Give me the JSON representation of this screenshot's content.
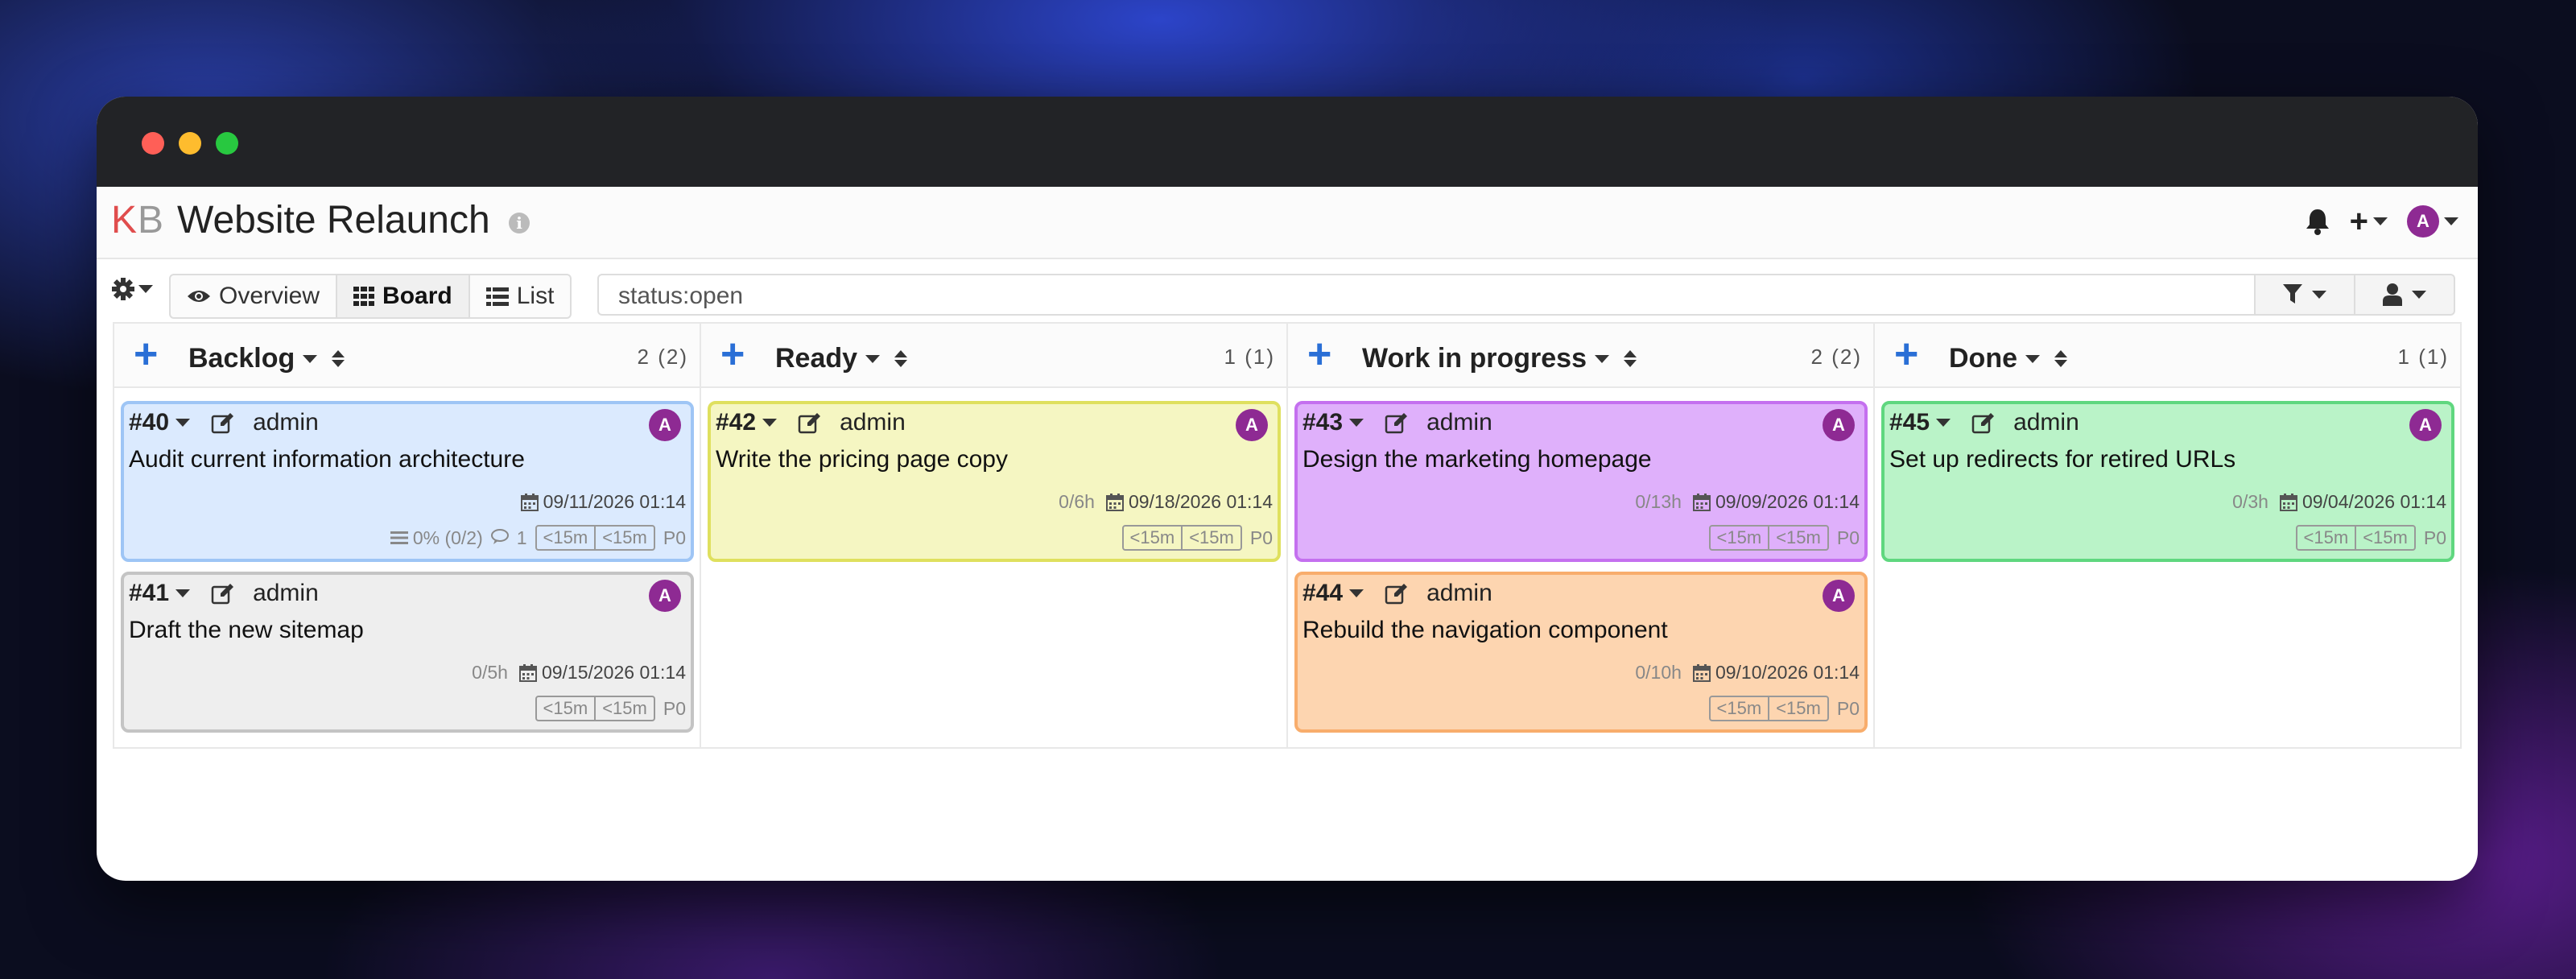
{
  "header": {
    "logo_k": "K",
    "logo_b": "B",
    "project_title": "Website Relaunch",
    "avatar_letter": "A"
  },
  "toolbar": {
    "views": [
      {
        "label": "Overview",
        "icon": "eye-icon"
      },
      {
        "label": "Board",
        "icon": "grid-icon",
        "active": true
      },
      {
        "label": "List",
        "icon": "list-icon"
      }
    ],
    "search_value": "status:open"
  },
  "columns": [
    {
      "title": "Backlog",
      "count": "2",
      "total": "(2)"
    },
    {
      "title": "Ready",
      "count": "1",
      "total": "(1)"
    },
    {
      "title": "Work in progress",
      "count": "2",
      "total": "(2)"
    },
    {
      "title": "Done",
      "count": "1",
      "total": "(1)"
    }
  ],
  "tasks": [
    {
      "id": "#40",
      "owner": "admin",
      "avatar": "A",
      "title": "Audit current information architecture",
      "time": "",
      "date": "09/11/2026 01:14",
      "progress": "0% (0/2)",
      "comments": "1",
      "est1": "<15m",
      "est2": "<15m",
      "priority": "P0",
      "color": "#dbeafe"
    },
    {
      "id": "#41",
      "owner": "admin",
      "avatar": "A",
      "title": "Draft the new sitemap",
      "time": "0/5h",
      "date": "09/15/2026 01:14",
      "est1": "<15m",
      "est2": "<15m",
      "priority": "P0",
      "color": "#eeeeee"
    },
    {
      "id": "#42",
      "owner": "admin",
      "avatar": "A",
      "title": "Write the pricing page copy",
      "time": "0/6h",
      "date": "09/18/2026 01:14",
      "est1": "<15m",
      "est2": "<15m",
      "priority": "P0",
      "color": "#f5f6c2"
    },
    {
      "id": "#43",
      "owner": "admin",
      "avatar": "A",
      "title": "Design the marketing homepage",
      "time": "0/13h",
      "date": "09/09/2026 01:14",
      "est1": "<15m",
      "est2": "<15m",
      "priority": "P0",
      "color": "#dfb0fb"
    },
    {
      "id": "#44",
      "owner": "admin",
      "avatar": "A",
      "title": "Rebuild the navigation component",
      "time": "0/10h",
      "date": "09/10/2026 01:14",
      "est1": "<15m",
      "est2": "<15m",
      "priority": "P0",
      "color": "#fdd5b0"
    },
    {
      "id": "#45",
      "owner": "admin",
      "avatar": "A",
      "title": "Set up redirects for retired URLs",
      "time": "0/3h",
      "date": "09/04/2026 01:14",
      "est1": "<15m",
      "est2": "<15m",
      "priority": "P0",
      "color": "#baf3c8"
    }
  ],
  "colors": {
    "accent_blue": "#2a6fd6",
    "avatar_purple": "#8e2a93",
    "logo_red": "#e04d4d"
  }
}
